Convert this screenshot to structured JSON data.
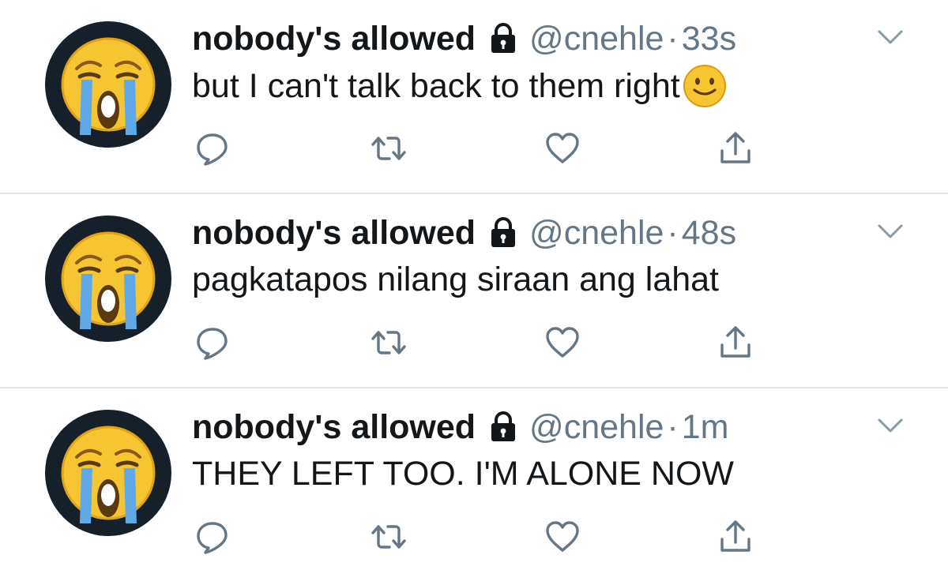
{
  "colors": {
    "text_primary": "#14171a",
    "text_secondary": "#657786",
    "divider": "#e1e8ed",
    "avatar_bg": "#15202b"
  },
  "icons": {
    "avatar": "loudly-crying-face-emoji",
    "lock": "lock-icon",
    "caret": "chevron-down-icon",
    "reply": "reply-icon",
    "retweet": "retweet-icon",
    "like": "heart-icon",
    "share": "share-icon",
    "smiley": "slightly-smiling-face-emoji"
  },
  "tweets": [
    {
      "display_name": "nobody's allowed",
      "handle": "@cnehle",
      "separator": "·",
      "time": "33s",
      "text": "but I can't talk back to them right",
      "trailing_emoji": "slightly-smiling-face"
    },
    {
      "display_name": "nobody's allowed",
      "handle": "@cnehle",
      "separator": "·",
      "time": "48s",
      "text": "pagkatapos nilang siraan ang lahat"
    },
    {
      "display_name": "nobody's allowed",
      "handle": "@cnehle",
      "separator": "·",
      "time": "1m",
      "text": "THEY LEFT TOO. I'M ALONE NOW"
    }
  ]
}
